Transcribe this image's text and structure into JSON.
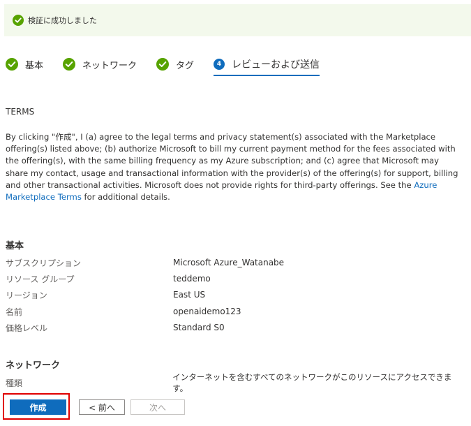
{
  "banner": {
    "message": "検証に成功しました",
    "icon": "check-circle-icon",
    "status_color": "#57a300"
  },
  "steps": [
    {
      "label": "基本",
      "state": "complete"
    },
    {
      "label": "ネットワーク",
      "state": "complete"
    },
    {
      "label": "タグ",
      "state": "complete"
    },
    {
      "label": "レビューおよび送信",
      "state": "current",
      "number": "4"
    }
  ],
  "terms": {
    "heading": "TERMS",
    "body_before_link": "By clicking \"作成\", I (a) agree to the legal terms and privacy statement(s) associated with the Marketplace offering(s) listed above; (b) authorize Microsoft to bill my current payment method for the fees associated with the offering(s), with the same billing frequency as my Azure subscription; and (c) agree that Microsoft may share my contact, usage and transactional information with the provider(s) of the offering(s) for support, billing and other transactional activities. Microsoft does not provide rights for third-party offerings. See the ",
    "link_text": "Azure Marketplace Terms",
    "body_after_link": " for additional details."
  },
  "basics": {
    "title": "基本",
    "rows": [
      {
        "key": "サブスクリプション",
        "value": "Microsoft Azure_Watanabe"
      },
      {
        "key": "リソース グループ",
        "value": "teddemo"
      },
      {
        "key": "リージョン",
        "value": "East US"
      },
      {
        "key": "名前",
        "value": "openaidemo123"
      },
      {
        "key": "価格レベル",
        "value": "Standard S0"
      }
    ]
  },
  "network": {
    "title": "ネットワーク",
    "rows": [
      {
        "key": "種類",
        "value": "インターネットを含むすべてのネットワークがこのリソースにアクセスできます。"
      }
    ]
  },
  "buttons": {
    "create": "作成",
    "prev": "< 前へ",
    "next": "次へ"
  },
  "colors": {
    "accent": "#0f6cbd",
    "success": "#57a300",
    "focus_outline": "#e00000"
  }
}
